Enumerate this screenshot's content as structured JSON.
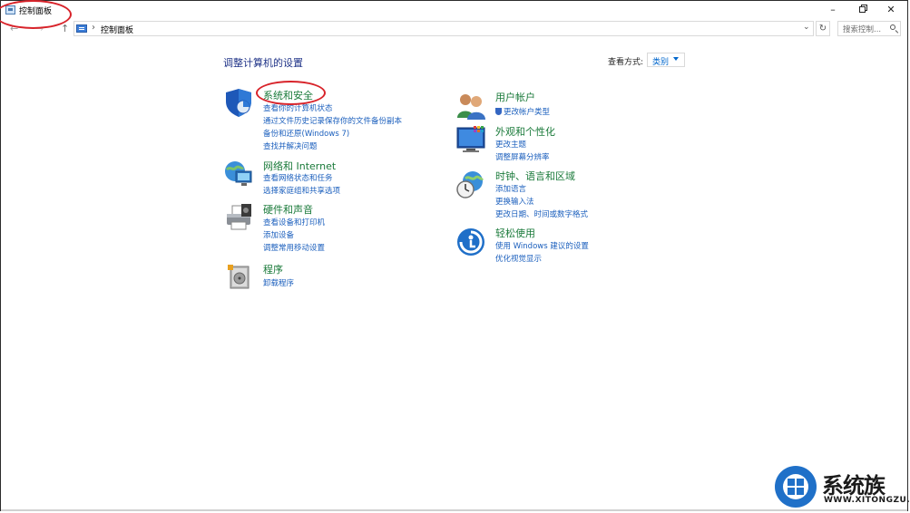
{
  "window": {
    "title": "控制面板",
    "minimize": "–",
    "close": "✕"
  },
  "address": {
    "crumb": "控制面板",
    "separator": "›",
    "search_placeholder": "搜索控制...",
    "back": "←",
    "forward": "→",
    "up": "↑",
    "dropdown": "⌄",
    "refresh": "↻"
  },
  "header": {
    "title": "调整计算机的设置",
    "view_by_label": "查看方式:",
    "view_by_value": "类别"
  },
  "left_categories": [
    {
      "icon": "shield-icon",
      "title": "系统和安全",
      "links": [
        "查看你的计算机状态",
        "通过文件历史记录保存你的文件备份副本",
        "备份和还原(Windows 7)",
        "查找并解决问题"
      ]
    },
    {
      "icon": "network-icon",
      "title": "网络和 Internet",
      "links": [
        "查看网络状态和任务",
        "选择家庭组和共享选项"
      ]
    },
    {
      "icon": "printer-icon",
      "title": "硬件和声音",
      "links": [
        "查看设备和打印机",
        "添加设备",
        "调整常用移动设置"
      ]
    },
    {
      "icon": "programs-icon",
      "title": "程序",
      "links": [
        "卸载程序"
      ]
    }
  ],
  "right_categories": [
    {
      "icon": "users-icon",
      "title": "用户帐户",
      "links": [
        "更改帐户类型"
      ]
    },
    {
      "icon": "appearance-icon",
      "title": "外观和个性化",
      "links": [
        "更改主题",
        "调整屏幕分辨率"
      ]
    },
    {
      "icon": "clock-globe-icon",
      "title": "时钟、语言和区域",
      "links": [
        "添加语言",
        "更换输入法",
        "更改日期、时间或数字格式"
      ]
    },
    {
      "icon": "accessibility-icon",
      "title": "轻松使用",
      "links": [
        "使用 Windows 建议的设置",
        "优化视觉显示"
      ]
    }
  ],
  "watermark": {
    "text": "系统族",
    "url": "WWW.XITONGZU.COM"
  },
  "colors": {
    "title_blue": "#1e3287",
    "category_green": "#1a7a3a",
    "link_blue": "#1b5fbd",
    "annotation_red": "#d8232a"
  }
}
